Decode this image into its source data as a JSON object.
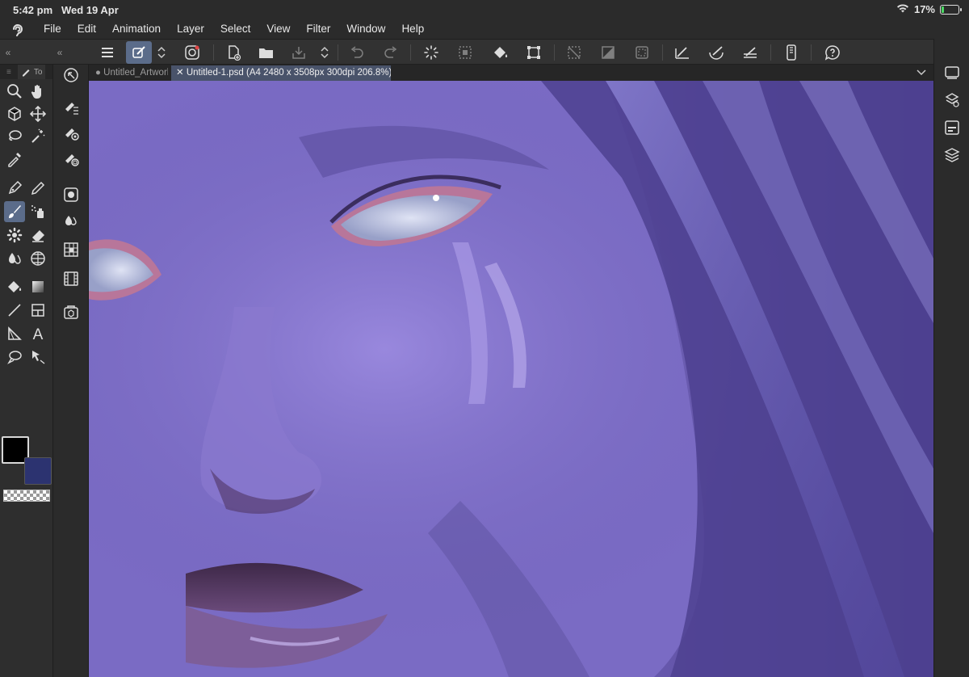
{
  "status": {
    "time": "5:42 pm",
    "date": "Wed 19 Apr",
    "battery": "17%",
    "battery_level": 0.17
  },
  "menu": [
    "File",
    "Edit",
    "Animation",
    "Layer",
    "Select",
    "View",
    "Filter",
    "Window",
    "Help"
  ],
  "tool_tab": "To",
  "tabs": [
    {
      "label": "Untitled_Artwork",
      "active": false,
      "marker": "●"
    },
    {
      "label": "Untitled-1.psd (A4 2480 x 3508px 300dpi 206.8%)",
      "active": true,
      "marker": "✕"
    }
  ],
  "colors": {
    "accent": "#5b6c8a",
    "main_color": "#000000",
    "sub_color": "#2c3370",
    "battery_fill": "#4cd964"
  }
}
